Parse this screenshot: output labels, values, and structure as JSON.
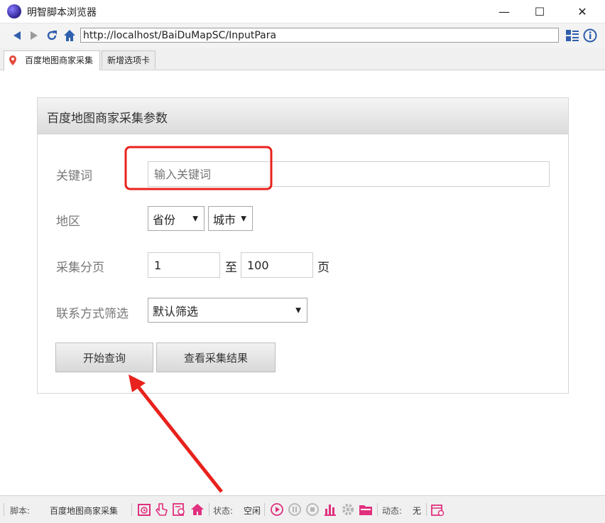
{
  "window": {
    "title": "明智脚本浏览器",
    "minimize": "—",
    "maximize": "☐",
    "close": "✕"
  },
  "navbar": {
    "url": "http://localhost/BaiDuMapSC/InputPara"
  },
  "tabs": [
    {
      "label": "百度地图商家采集"
    },
    {
      "label": "新增选项卡"
    }
  ],
  "form": {
    "title": "百度地图商家采集参数",
    "keyword": {
      "label": "关键词",
      "placeholder": "输入关键词"
    },
    "region": {
      "label": "地区",
      "province": "省份",
      "city": "城市"
    },
    "pages": {
      "label": "采集分页",
      "from": "1",
      "to_label": "至",
      "to": "100",
      "unit": "页"
    },
    "contact": {
      "label": "联系方式筛选",
      "value": "默认筛选"
    },
    "start_button": "开始查询",
    "results_button": "查看采集结果"
  },
  "statusbar": {
    "script_label": "脚本:",
    "script_name": "百度地图商家采集",
    "state_label": "状态:",
    "state_value": "空闲",
    "dynamic_label": "动态:",
    "dynamic_value": "无"
  },
  "colors": {
    "accent_pink": "#e0307e",
    "annotation_red": "#e8221c"
  }
}
